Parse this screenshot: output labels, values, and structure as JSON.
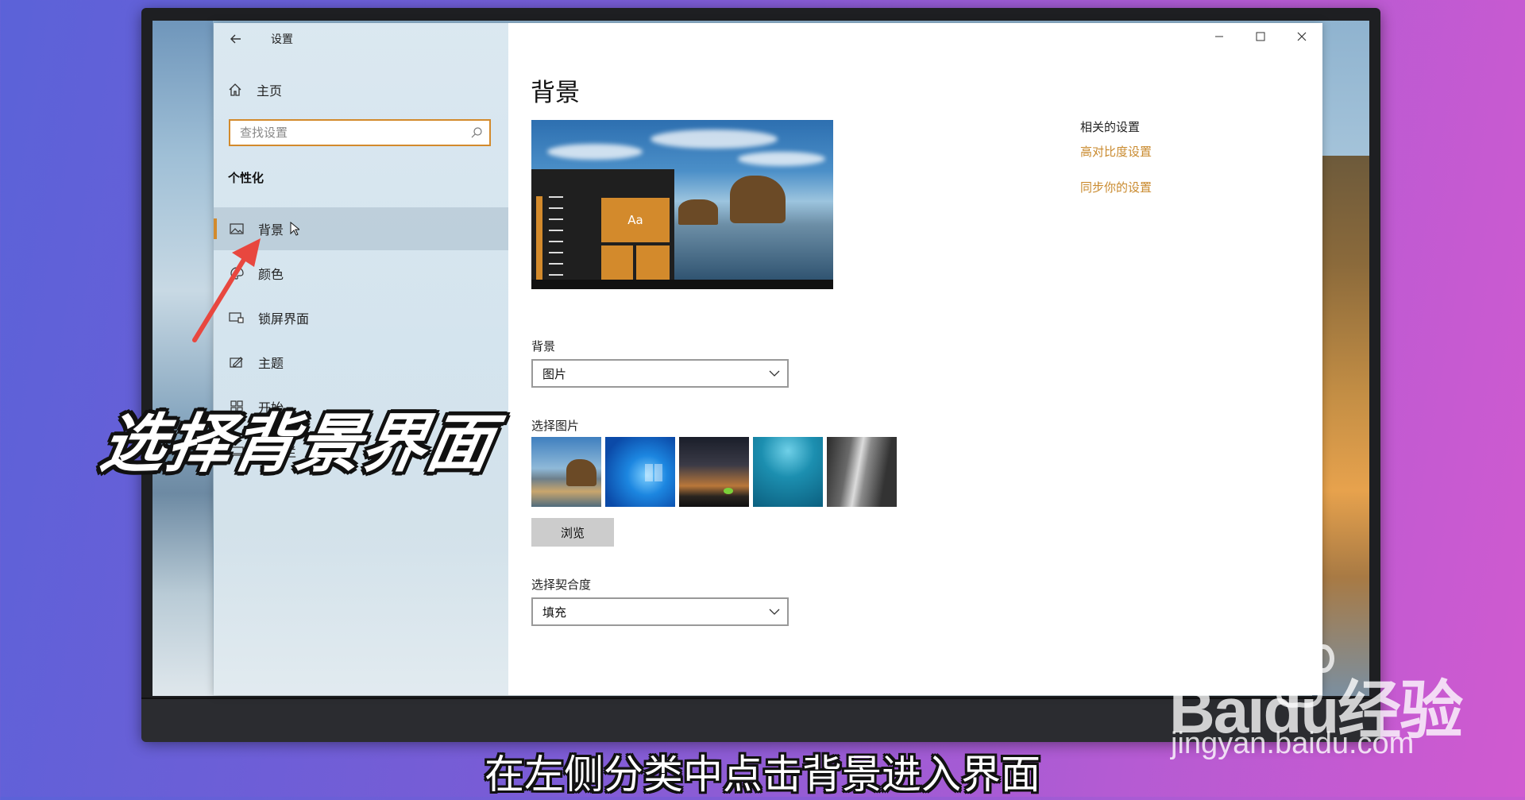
{
  "window": {
    "title": "设置"
  },
  "sidebar": {
    "home_label": "主页",
    "search_placeholder": "查找设置",
    "section_title": "个性化",
    "items": [
      {
        "label": "背景",
        "icon": "image-icon",
        "active": true
      },
      {
        "label": "颜色",
        "icon": "palette-icon"
      },
      {
        "label": "锁屏界面",
        "icon": "lock-screen-icon"
      },
      {
        "label": "主题",
        "icon": "theme-icon"
      },
      {
        "label": "开始",
        "icon": "start-icon"
      },
      {
        "label": "任务栏",
        "icon": "taskbar-icon"
      }
    ]
  },
  "content": {
    "page_title": "背景",
    "preview_tile_text": "Aa",
    "background_label": "背景",
    "background_value": "图片",
    "choose_picture_label": "选择图片",
    "browse_label": "浏览",
    "fit_label": "选择契合度",
    "fit_value": "填充",
    "related_title": "相关的设置",
    "related_links": [
      "高对比度设置",
      "同步你的设置"
    ]
  },
  "overlay": {
    "caption": "选择背景界面",
    "subtitle": "在左侧分类中点击背景进入界面",
    "watermark_logo": "Baidu经验",
    "watermark_url": "jingyan.baidu.com"
  },
  "colors": {
    "accent": "#d38a2c",
    "link": "#c98a2e",
    "active_bg": "#b9c8d3"
  }
}
